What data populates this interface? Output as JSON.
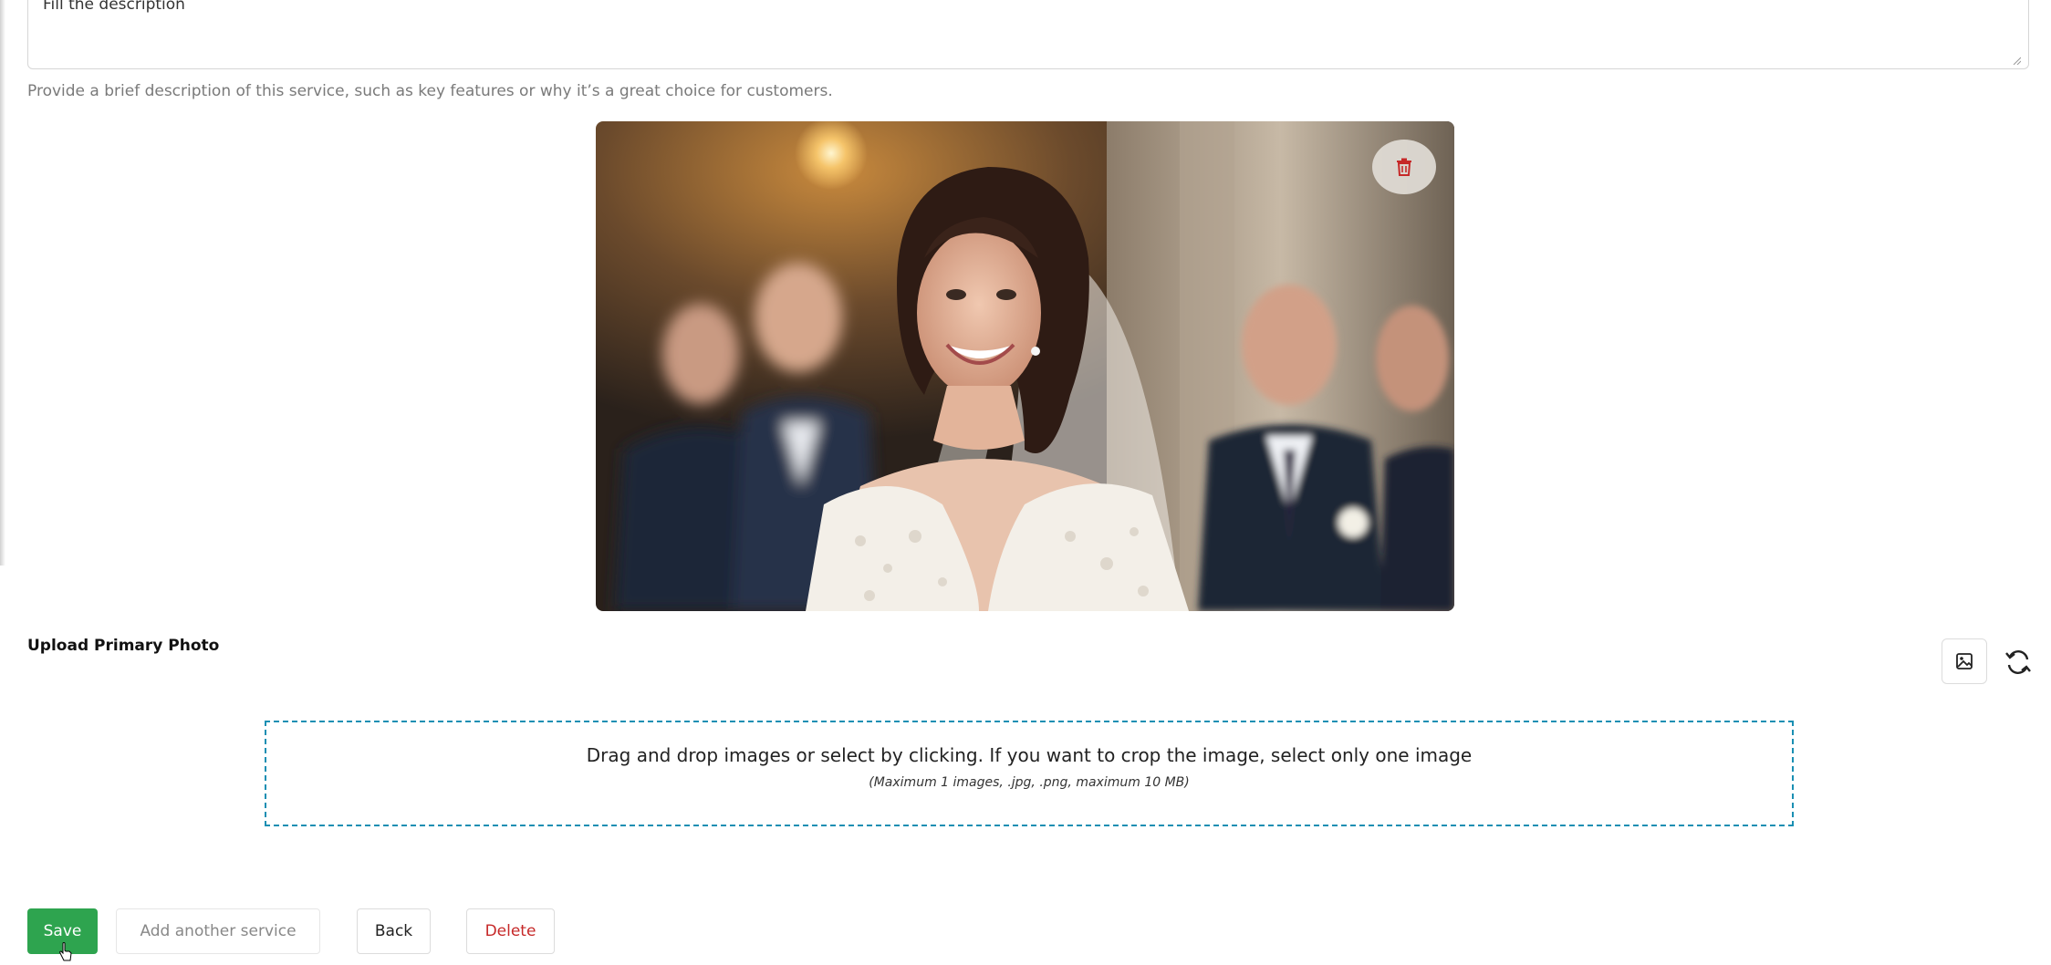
{
  "description": {
    "value": "Fill the description",
    "help_text": "Provide a brief description of this service, such as key features or why it’s a great choice for customers."
  },
  "photo": {
    "subject": "bride in veil with groomsmen",
    "delete_icon": "trash-icon"
  },
  "upload": {
    "label": "Upload Primary Photo",
    "image_tool_icon": "image-icon",
    "refresh_icon": "refresh-icon",
    "dropzone_text": "Drag and drop images or select by clicking. If you want to crop the image, select only one image",
    "dropzone_hint": "(Maximum 1 images, .jpg, .png, maximum 10 MB)"
  },
  "actions": {
    "save": "Save",
    "add_another": "Add another service",
    "back": "Back",
    "delete": "Delete"
  },
  "colors": {
    "save": "#2ea44f",
    "delete_text": "#c62828",
    "dropzone_border": "#1a8fb3",
    "trash": "#c62828"
  }
}
